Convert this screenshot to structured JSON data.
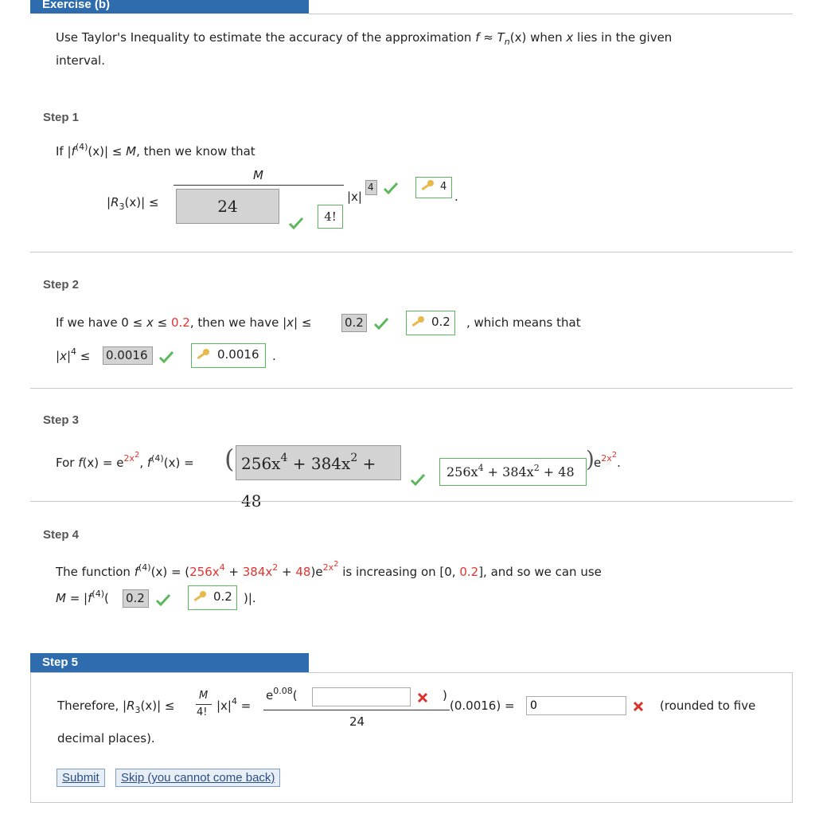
{
  "exercise_header": "Exercise (b)",
  "intro": {
    "text_a": "Use Taylor's Inequality to estimate the accuracy of the approximation ",
    "f": "f",
    "approx": " ≈ ",
    "T": "T",
    "n": "n",
    "xpart": "(x)",
    "text_b": " when ",
    "x": "x",
    "text_c": " lies in the given",
    "line2": "interval."
  },
  "step1": {
    "title": "Step 1",
    "if_text": "If |",
    "f": "f",
    "sup4": "(4)",
    "rest": "(x)| ≤ ",
    "M": "M",
    "then": ", then we know that",
    "numerator": "M",
    "R_left": "|",
    "R": "R",
    "R_sub": "3",
    "R_right": "(x)| ≤",
    "answer_denominator": "24",
    "key_denominator": "4!",
    "absx": "|x|",
    "answer_exponent": "4",
    "key_exponent": "4",
    "period": "."
  },
  "step2": {
    "title": "Step 2",
    "t1": "If we have 0 ≤ ",
    "x1": "x",
    "t2": " ≤ ",
    "t2red": "0.2",
    "t3": ", then we have |",
    "x2": "x",
    "t4": "| ≤",
    "answer1": "0.2",
    "key1": "0.2",
    "t5": ", which means that",
    "abs_l": "|",
    "x3": "x",
    "abs_r": "|",
    "sup4": "4",
    "le": " ≤",
    "answer2": "0.0016",
    "key2": "0.0016",
    "period": "."
  },
  "step3": {
    "title": "Step 3",
    "t1": "For ",
    "f1": "f",
    "t2": "(x) = ",
    "e1": "e",
    "exp1": "2x",
    "exp1sup": "2",
    "t3": ", ",
    "f2": "f",
    "f2sup": "(4)",
    "t4": "(x) =",
    "answer": "256x",
    "answer_sup1": "4",
    "answer_mid": " + 384x",
    "answer_sup2": "2",
    "answer_end": " + 48",
    "key": "256x",
    "key_sup1": "4",
    "key_mid": " + 384x",
    "key_sup2": "2",
    "key_end": " + 48",
    "e2": "e",
    "exp2": "2x",
    "exp2sup": "2",
    "period": "."
  },
  "step4": {
    "title": "Step 4",
    "t1": "The function ",
    "f": "f",
    "fsup": "(4)",
    "t2": "(x) = (",
    "r1": "256x",
    "r1sup": "4",
    "t3": " + ",
    "r2": "384x",
    "r2sup": "2",
    "t4": " + ",
    "r3": "48",
    "t5": ")e",
    "expo": "2x",
    "exposup": "2",
    "t6": " is increasing on [0, ",
    "r4": "0.2",
    "t7": "], and so we can use",
    "M": "M",
    "t8": " = |",
    "f2": "f",
    "f2sup": "(4)",
    "t9": "(",
    "answer": "0.2",
    "key": "0.2",
    "t10": ")|."
  },
  "step5": {
    "title": "Step 5",
    "t1": "Therefore, |",
    "R": "R",
    "Rsub": "3",
    "t2": "(x)| ≤",
    "M": "M",
    "fact": "4!",
    "absx": "|x|",
    "absxsup": "4",
    "eq": " =",
    "e": "e",
    "esup": "0.08",
    "open": "(",
    "input1_value": "",
    "close": ")",
    "denominator": "24",
    "t3": "(0.0016)",
    "eq2": " =",
    "input2_value": "0",
    "rounded": "(rounded to five",
    "line2": "decimal places).",
    "submit": "Submit",
    "skip": "Skip (you cannot come back)"
  },
  "colors": {
    "header_blue": "#2f6cad",
    "red": "#e3342f",
    "check_green": "#5cb85c",
    "x_red": "#d9322b"
  }
}
